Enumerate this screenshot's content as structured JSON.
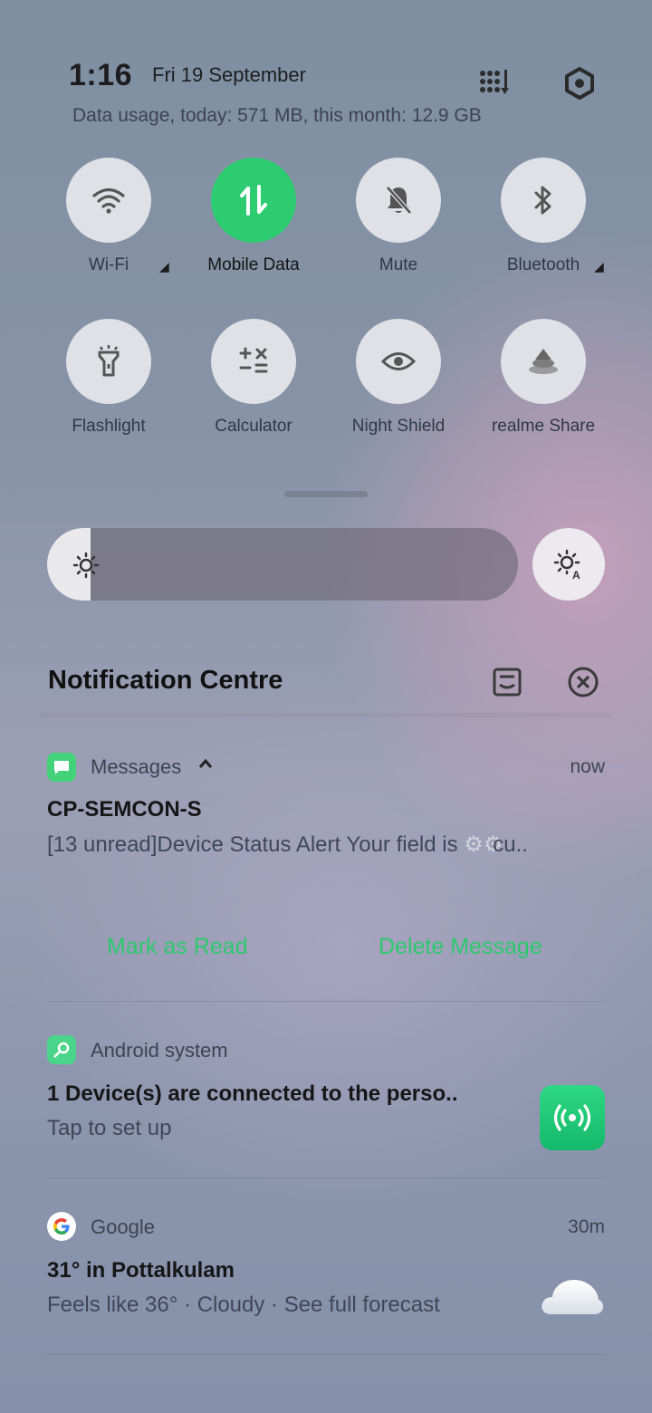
{
  "status": {
    "time": "1:16",
    "date": "Fri 19 September",
    "data_usage": "Data usage, today: 571 MB, this month: 12.9 GB",
    "icons": [
      "grid-edit-icon",
      "settings-hexagon-icon"
    ]
  },
  "quick_tiles": [
    {
      "label": "Wi-Fi",
      "icon": "wifi-icon",
      "active": false,
      "has_arrow": true
    },
    {
      "label": "Mobile Data",
      "icon": "mobile-data-icon",
      "active": true,
      "has_arrow": false
    },
    {
      "label": "Mute",
      "icon": "bell-off-icon",
      "active": false,
      "has_arrow": false
    },
    {
      "label": "Bluetooth",
      "icon": "bluetooth-icon",
      "active": false,
      "has_arrow": true
    },
    {
      "label": "Flashlight",
      "icon": "flashlight-icon",
      "active": false,
      "has_arrow": false
    },
    {
      "label": "Calculator",
      "icon": "calculator-icon",
      "active": false,
      "has_arrow": false
    },
    {
      "label": "Night Shield",
      "icon": "eye-icon",
      "active": false,
      "has_arrow": false
    },
    {
      "label": "realme Share",
      "icon": "realme-share-icon",
      "active": false,
      "has_arrow": false
    }
  ],
  "brightness": {
    "level": 0.09,
    "auto_icon": "auto-brightness-icon"
  },
  "notification_centre": {
    "title": "Notification Centre",
    "icons": [
      "manage-icon",
      "clear-all-icon"
    ]
  },
  "notifications": {
    "messages": {
      "app": "Messages",
      "time": "now",
      "title": "CP-SEMCON-S",
      "body": "[13 unread]Device Status Alert Your field is",
      "body_tail": "cu..",
      "actions": {
        "mark_read": "Mark as Read",
        "delete": "Delete Message"
      }
    },
    "android": {
      "app": "Android system",
      "title": "1 Device(s) are connected to the perso..",
      "body": "Tap to set up"
    },
    "google": {
      "app": "Google",
      "time": "30m",
      "title": "31° in Pottalkulam",
      "body": "Feels like 36° · Cloudy · See full forecast"
    }
  },
  "colors": {
    "accent": "#2ecc71",
    "tile_bg": "#dfe1e6"
  }
}
